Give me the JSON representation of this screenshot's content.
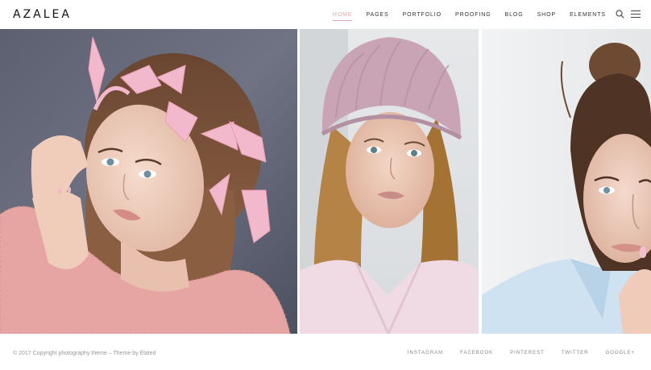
{
  "header": {
    "logo": "AZALEA",
    "nav": [
      {
        "label": "HOME",
        "active": true
      },
      {
        "label": "PAGES",
        "active": false
      },
      {
        "label": "PORTFOLIO",
        "active": false
      },
      {
        "label": "PROOFING",
        "active": false
      },
      {
        "label": "BLOG",
        "active": false
      },
      {
        "label": "SHOP",
        "active": false
      },
      {
        "label": "ELEMENTS",
        "active": false
      }
    ],
    "icons": {
      "search": "search-icon",
      "menu": "hamburger-menu-icon"
    }
  },
  "gallery": {
    "photos": [
      {
        "subject": "woman with pink ribbons in hair, pink sweater"
      },
      {
        "subject": "woman in pink knit beanie and pink coat"
      },
      {
        "subject": "woman with hair bun, light blue shirt"
      }
    ]
  },
  "footer": {
    "copyright": "© 2017 Copyright photography theme – Theme by Elated",
    "socials": [
      "INSTAGRAM",
      "FACEBOOK",
      "PINTEREST",
      "TWITTER",
      "GOOGLE+"
    ]
  },
  "colors": {
    "accent": "#d8a6a6",
    "text": "#333333",
    "muted": "#999999"
  }
}
